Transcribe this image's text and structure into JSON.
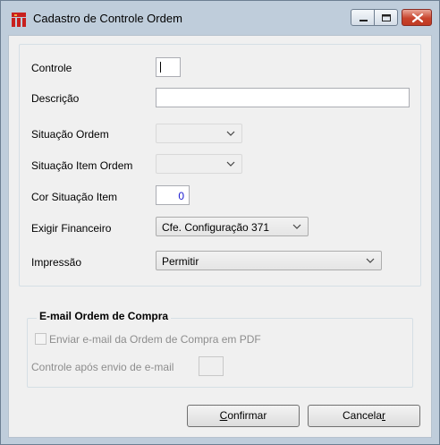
{
  "window": {
    "title": "Cadastro de Controle Ordem"
  },
  "form": {
    "controle": {
      "label": "Controle",
      "value": ""
    },
    "descricao": {
      "label": "Descrição",
      "value": ""
    },
    "situacao_ordem": {
      "label": "Situação Ordem",
      "value": ""
    },
    "situacao_item_ordem": {
      "label": "Situação Item Ordem",
      "value": ""
    },
    "cor_situacao_item": {
      "label": "Cor Situação Item",
      "value": "0"
    },
    "exigir_financeiro": {
      "label": "Exigir Financeiro",
      "value": "Cfe. Configuração 371"
    },
    "impressao": {
      "label": "Impressão",
      "value": "Permitir"
    }
  },
  "email_group": {
    "title": "E-mail Ordem de Compra",
    "enviar_email": {
      "label": "Enviar e-mail da Ordem de Compra em PDF",
      "checked": false
    },
    "controle_apos_envio": {
      "label": "Controle após envio de e-mail",
      "value": ""
    }
  },
  "buttons": {
    "confirmar": {
      "pre": "",
      "mnemonic": "C",
      "post": "onfirmar"
    },
    "cancelar": {
      "pre": "Cancela",
      "mnemonic": "r",
      "post": ""
    }
  },
  "icons": {
    "app": "app-logo-icon",
    "minimize": "minimize-icon",
    "maximize": "maximize-icon",
    "close": "close-icon",
    "dropdown": "chevron-down-icon"
  },
  "colors": {
    "titlebar": "#bfcddb",
    "close_button": "#c8442d",
    "numeric_text": "#1a1ad0"
  }
}
